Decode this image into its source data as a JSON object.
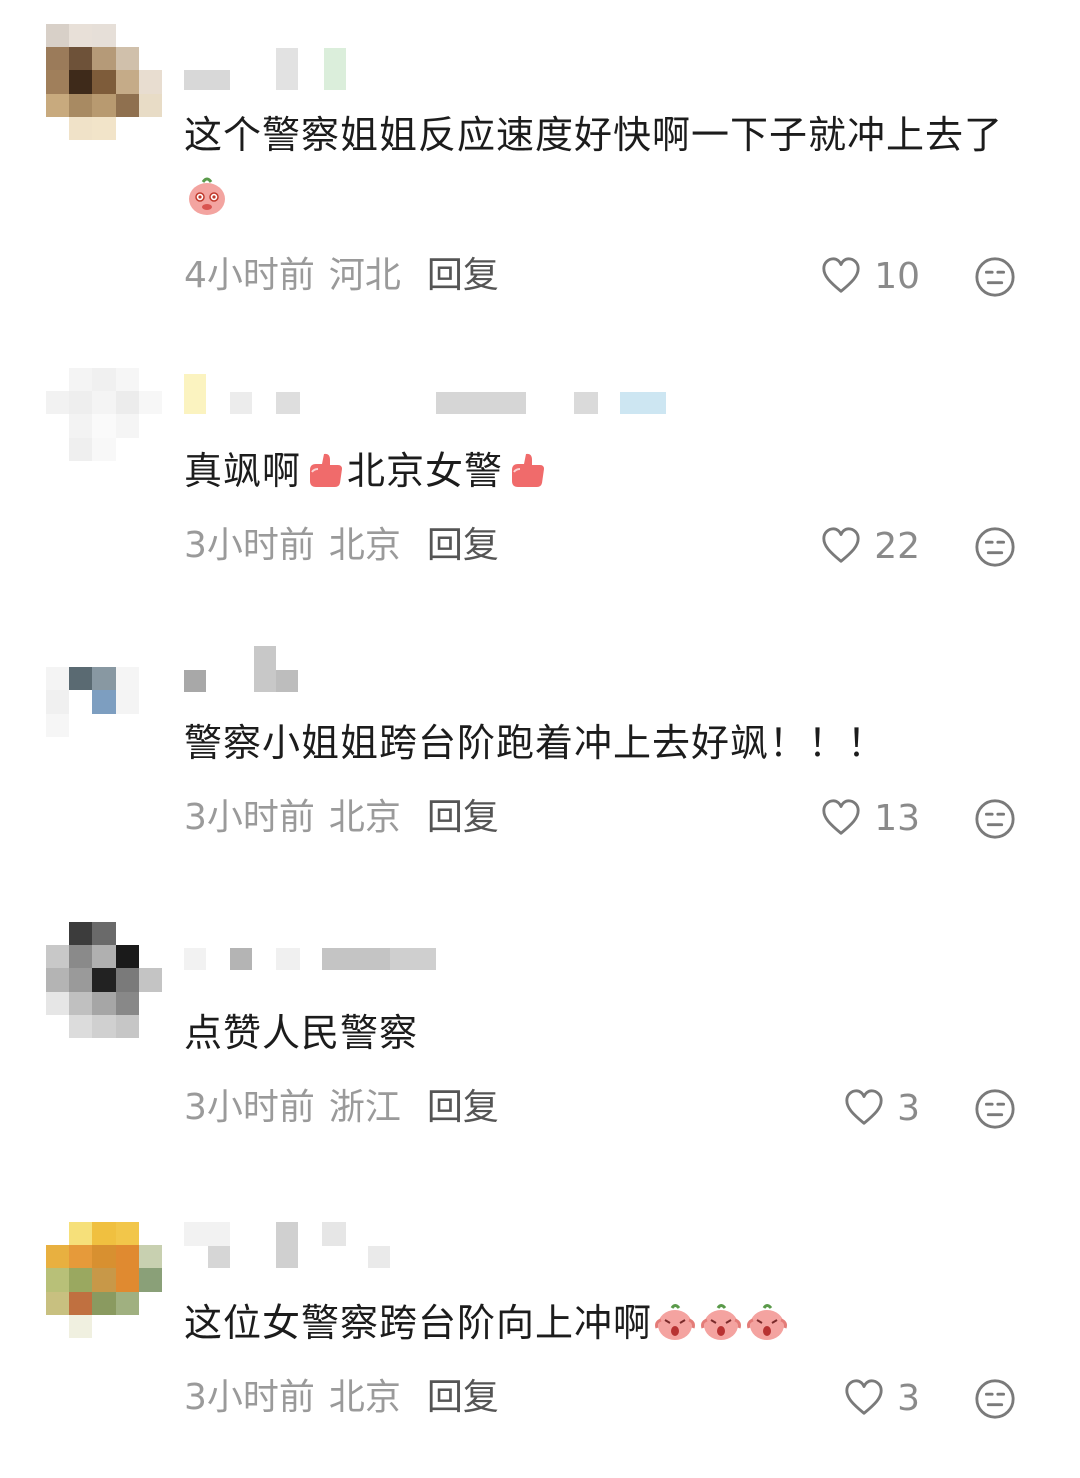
{
  "comments": [
    {
      "text": "这个警察姐姐反应速度好快啊一下子就冲上去了",
      "time": "4小时前",
      "location": "河北",
      "reply_label": "回复",
      "likes": "10"
    },
    {
      "text_part1": "真飒啊",
      "text_part2": "北京女警",
      "time": "3小时前",
      "location": "北京",
      "reply_label": "回复",
      "likes": "22"
    },
    {
      "text": "警察小姐姐跨台阶跑着冲上去好飒！！！",
      "time": "3小时前",
      "location": "北京",
      "reply_label": "回复",
      "likes": "13"
    },
    {
      "text": "点赞人民警察",
      "time": "3小时前",
      "location": "浙江",
      "reply_label": "回复",
      "likes": "3"
    },
    {
      "text": "这位女警察跨台阶向上冲啊",
      "time": "3小时前",
      "location": "北京",
      "reply_label": "回复",
      "likes": "3"
    }
  ],
  "icons": {
    "like": "heart-outline-icon",
    "more": "neutral-face-icon",
    "emoji_shy": "shy-peach-emoji",
    "emoji_thumb": "thumbs-up-emoji",
    "emoji_scream": "screaming-peach-emoji"
  },
  "colors": {
    "text": "#1c1c1c",
    "meta": "#9a9a9a",
    "reply": "#555555",
    "icon": "#8a8a8a"
  }
}
